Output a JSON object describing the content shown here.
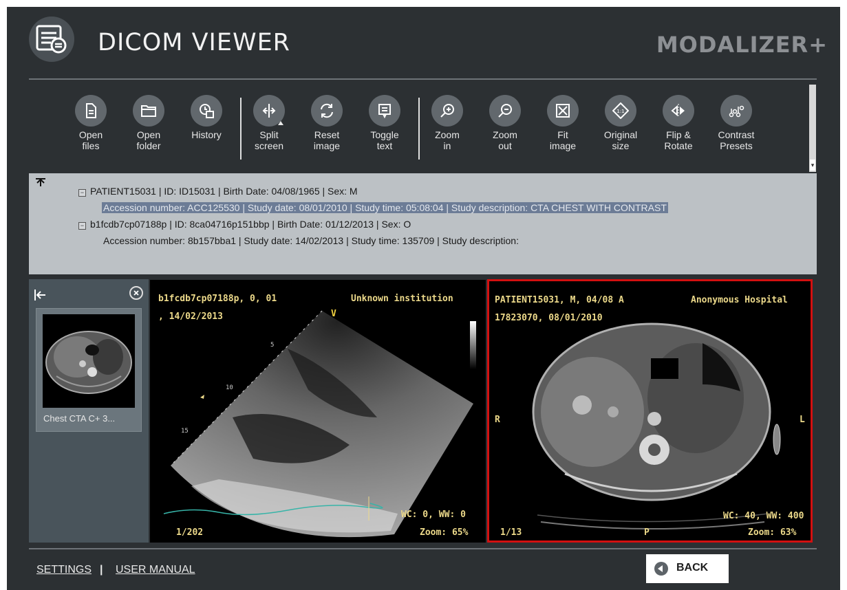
{
  "header": {
    "title": "DICOM VIEWER",
    "brand": "MODALIZER+"
  },
  "toolbar": {
    "items": [
      {
        "label": "Open\nfiles",
        "icon": "file-icon"
      },
      {
        "label": "Open\nfolder",
        "icon": "folder-icon"
      },
      {
        "label": "History",
        "icon": "history-icon"
      },
      {
        "label": "Split\nscreen",
        "icon": "split-icon"
      },
      {
        "label": "Reset\nimage",
        "icon": "reset-icon"
      },
      {
        "label": "Toggle\ntext",
        "icon": "toggle-text-icon"
      },
      {
        "label": "Zoom\nin",
        "icon": "zoom-in-icon"
      },
      {
        "label": "Zoom\nout",
        "icon": "zoom-out-icon"
      },
      {
        "label": "Fit\nimage",
        "icon": "fit-icon"
      },
      {
        "label": "Original\nsize",
        "icon": "original-size-icon"
      },
      {
        "label": "Flip &\nRotate",
        "icon": "flip-rotate-icon"
      },
      {
        "label": "Contrast\nPresets",
        "icon": "contrast-icon"
      }
    ]
  },
  "patients": [
    {
      "header": "PATIENT15031 | ID: ID15031 | Birth Date: 04/08/1965 | Sex: M",
      "study": "Accession number: ACC125530 | Study date: 08/01/2010 | Study time: 05:08:04 | Study description: CTA CHEST WITH CONTRAST",
      "selected": true
    },
    {
      "header": "b1fcdb7cp07188p | ID: 8ca04716p151bbp | Birth Date: 01/12/2013 | Sex: O",
      "study": "Accession number: 8b157bba1 | Study date: 14/02/2013 | Study time: 135709 | Study description:",
      "selected": false
    }
  ],
  "series_thumb": {
    "caption": "Chest  CTA C+  3..."
  },
  "viewport_left": {
    "top_left_1": "b1fcdb7cp07188p, 0, 01",
    "top_left_2": ", 14/02/2013",
    "top_right": "Unknown institution",
    "marker_v": "V",
    "depth_5": "5",
    "depth_10": "10",
    "depth_15": "15",
    "wc_ww": "WC: 0, WW: 0",
    "zoom": "Zoom: 65%",
    "frame": "1/202"
  },
  "viewport_right": {
    "top_left_1": "PATIENT15031, M, 04/08 A",
    "top_left_2": "17823070, 08/01/2010",
    "top_right": "Anonymous Hospital",
    "orient_left": "R",
    "orient_right": "L",
    "orient_bottom": "P",
    "wc_ww": "WC: 40, WW: 400",
    "zoom": "Zoom: 63%",
    "frame": "1/13"
  },
  "footer": {
    "settings": "SETTINGS",
    "separator": "|",
    "manual": "USER MANUAL",
    "back": "BACK"
  },
  "colors": {
    "background": "#2c3033",
    "info_panel": "#bcc1c5",
    "selection": "#6c7c96",
    "active_viewport_border": "#d31010",
    "overlay_text": "#ecd98a"
  }
}
